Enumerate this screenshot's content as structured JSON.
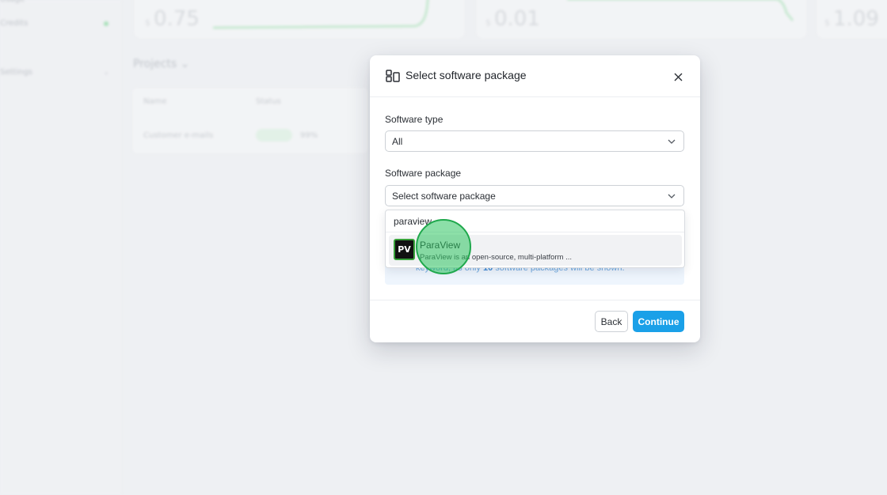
{
  "background": {
    "sidebar_items": [
      "",
      "",
      ""
    ],
    "metrics": [
      {
        "prefix": "$",
        "value": "0.75"
      },
      {
        "prefix": "$",
        "value": "0.01"
      },
      {
        "prefix": "$",
        "value": "1.09"
      }
    ],
    "section_title": "Projects",
    "table_headers": [
      "Name",
      "Status"
    ],
    "table_row": {
      "name": "Customer e-mails",
      "status": "Active",
      "extra": "99%"
    }
  },
  "modal": {
    "title": "Select software package",
    "header_icon": "package-icon",
    "close_icon": "close-icon",
    "software_type": {
      "label": "Software type",
      "value": "All"
    },
    "software_package": {
      "label": "Software package",
      "placeholder": "Select software package"
    },
    "info": {
      "text_before": "keyword, as only ",
      "count": "10",
      "text_after": " software packages will be shown."
    },
    "footer": {
      "back_label": "Back",
      "continue_label": "Continue"
    }
  },
  "dropdown": {
    "search_value": "paraview",
    "options": [
      {
        "logo_text": "PV",
        "title": "ParaView",
        "description": "ParaView is an open-source, multi-platform ..."
      }
    ]
  },
  "colors": {
    "accent": "#1aa0e8",
    "info_bg": "#eef5fd",
    "info_text": "#6aa6df",
    "click_indicator": "#2ec460"
  }
}
